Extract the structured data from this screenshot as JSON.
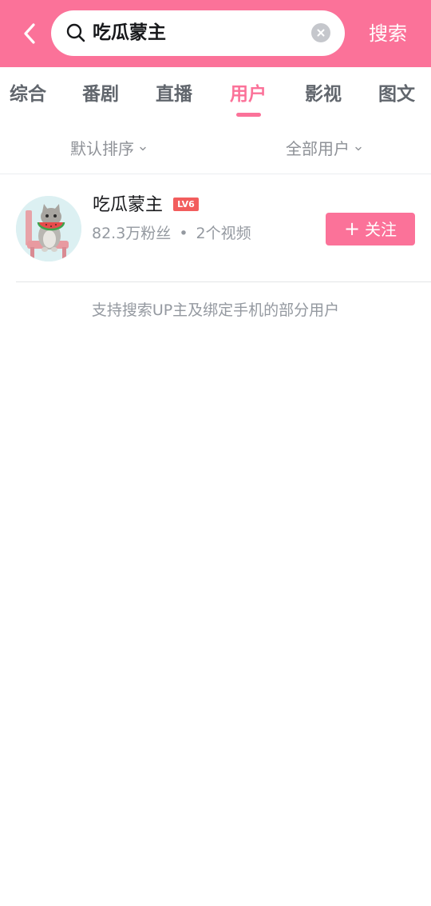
{
  "search": {
    "query": "吃瓜蒙主",
    "submit_label": "搜索"
  },
  "tabs": [
    {
      "label": "综合"
    },
    {
      "label": "番剧"
    },
    {
      "label": "直播"
    },
    {
      "label": "用户",
      "active": true
    },
    {
      "label": "影视"
    },
    {
      "label": "图文"
    }
  ],
  "filters": {
    "sort": "默认排序",
    "scope": "全部用户"
  },
  "user": {
    "name": "吃瓜蒙主",
    "level": "LV6",
    "followers": "82.3万粉丝",
    "separator": "•",
    "videos": "2个视频",
    "follow_label": "关注",
    "avatar_icon": "cat-eating-watermelon-avatar"
  },
  "hint": "支持搜索UP主及绑定手机的部分用户",
  "colors": {
    "accent": "#fb7299",
    "level_badge": "#f25d5d"
  }
}
